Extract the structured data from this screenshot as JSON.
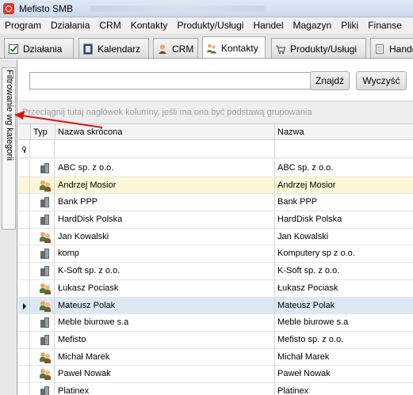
{
  "window": {
    "title": "Mefisto SMB"
  },
  "menu": [
    "Program",
    "Działania",
    "CRM",
    "Kontakty",
    "Produkty/Usługi",
    "Handel",
    "Magazyn",
    "Pliki",
    "Finanse"
  ],
  "tabs": [
    {
      "label": "Działania",
      "icon": "checklist-icon",
      "active": false
    },
    {
      "label": "Kalendarz",
      "icon": "calendar-icon",
      "active": false
    },
    {
      "label": "CRM",
      "icon": "person-icon",
      "active": false
    },
    {
      "label": "Kontakty",
      "icon": "contacts-icon",
      "active": true
    },
    {
      "label": "Produkty/Usługi",
      "icon": "cart-icon",
      "active": false
    },
    {
      "label": "Handel",
      "icon": "document-icon",
      "active": false
    }
  ],
  "side_panel": {
    "label": "Filtrowanie wg kategorii"
  },
  "search": {
    "value": "",
    "find_button": "Znajdź",
    "clear_button": "Wyczyść"
  },
  "grouping": {
    "hint": "Przeciągnij tutaj nagłówek kolumny, jeśli ma ona być podstawą grupowania"
  },
  "grid": {
    "columns": [
      "Typ",
      "Nazwa skrócona",
      "Nazwa"
    ],
    "rows": [
      {
        "type": "company",
        "short": "ABC sp. z o.o.",
        "name": "ABC sp. z o.o.",
        "state": ""
      },
      {
        "type": "person",
        "short": "Andrzej Mosior",
        "name": "Andrzej Mosior",
        "state": "selected"
      },
      {
        "type": "company",
        "short": "Bank PPP",
        "name": "Bank PPP",
        "state": ""
      },
      {
        "type": "company",
        "short": "HardDisk Polska",
        "name": "HardDisk Polska",
        "state": ""
      },
      {
        "type": "person",
        "short": "Jan Kowalski",
        "name": "Jan Kowalski",
        "state": ""
      },
      {
        "type": "company",
        "short": "komp",
        "name": "Komputery sp z o.o.",
        "state": ""
      },
      {
        "type": "company",
        "short": "K-Soft sp. z o.o.",
        "name": "K-Soft sp. z o.o.",
        "state": ""
      },
      {
        "type": "person",
        "short": "Łukasz Pociask",
        "name": "Łukasz Pociask",
        "state": ""
      },
      {
        "type": "person",
        "short": "Mateusz Polak",
        "name": "Mateusz Polak",
        "state": "current"
      },
      {
        "type": "company",
        "short": "Meble biurowe s.a",
        "name": "Meble biurowe s.a",
        "state": ""
      },
      {
        "type": "company",
        "short": "Mefisto",
        "name": "Mefisto sp. z o.o.",
        "state": ""
      },
      {
        "type": "person",
        "short": "Michał Marek",
        "name": "Michał Marek",
        "state": ""
      },
      {
        "type": "person",
        "short": "Paweł Nowak",
        "name": "Paweł Nowak",
        "state": ""
      },
      {
        "type": "company",
        "short": "Platinex",
        "name": "Platinex",
        "state": ""
      }
    ]
  },
  "colors": {
    "selected_row": "#fdf7d8",
    "current_row": "#dde8f6",
    "annotation_arrow": "#e01010"
  }
}
